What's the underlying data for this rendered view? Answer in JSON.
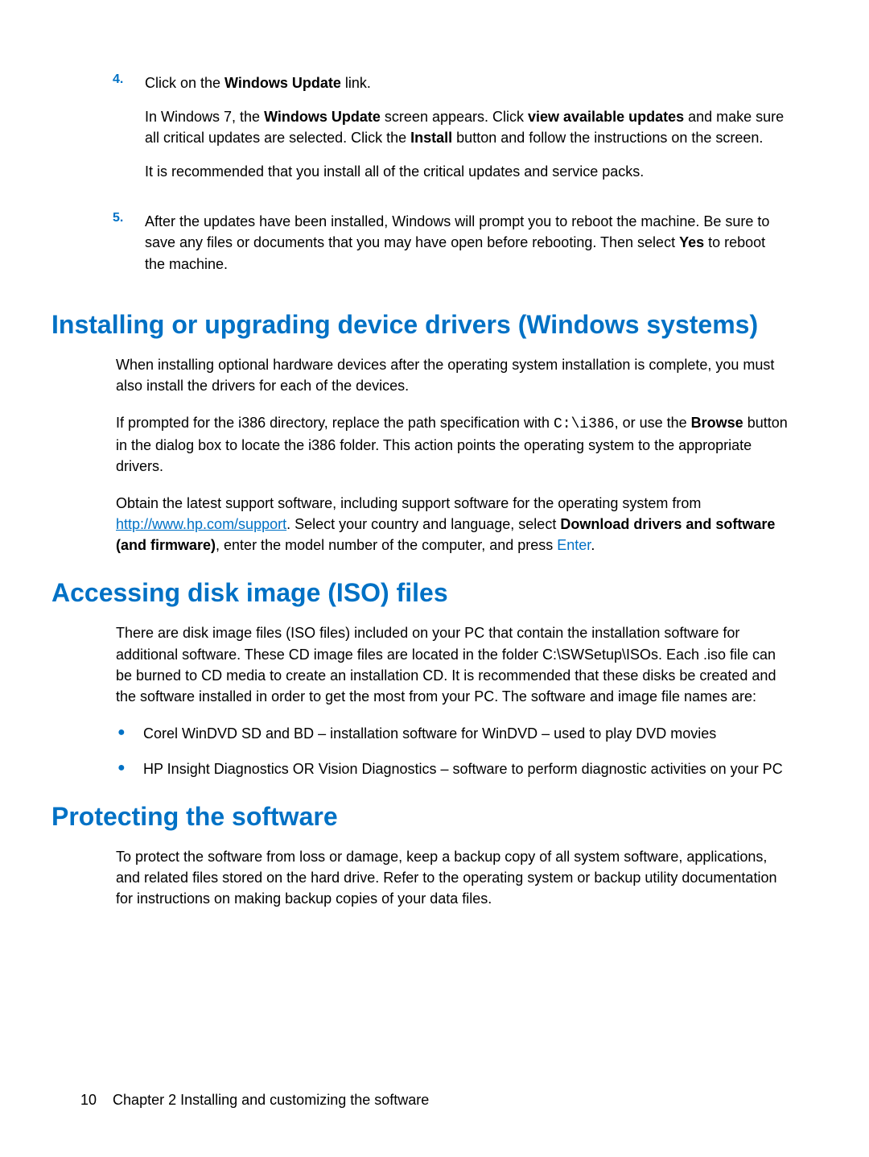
{
  "steps": {
    "s4": {
      "num": "4.",
      "line1_a": "Click on the ",
      "line1_b": "Windows Update",
      "line1_c": " link.",
      "line2_a": "In Windows 7, the ",
      "line2_b": "Windows Update",
      "line2_c": " screen appears. Click ",
      "line2_d": "view available updates",
      "line2_e": " and make sure all critical updates are selected. Click the ",
      "line2_f": "Install",
      "line2_g": " button and follow the instructions on the screen.",
      "line3": "It is recommended that you install all of the critical updates and service packs."
    },
    "s5": {
      "num": "5.",
      "line1_a": "After the updates have been installed, Windows will prompt you to reboot the machine. Be sure to save any files or documents that you may have open before rebooting. Then select ",
      "line1_b": "Yes",
      "line1_c": " to reboot the machine."
    }
  },
  "sections": {
    "installing": {
      "title": "Installing or upgrading device drivers (Windows systems)",
      "p1": "When installing optional hardware devices after the operating system installation is complete, you must also install the drivers for each of the devices.",
      "p2_a": "If prompted for the i386 directory, replace the path specification with ",
      "p2_mono": "C:\\i386",
      "p2_b": ", or use the ",
      "p2_bold": "Browse",
      "p2_c": " button in the dialog box to locate the i386 folder. This action points the operating system to the appropriate drivers.",
      "p3_a": "Obtain the latest support software, including support software for the operating system from ",
      "p3_link": "http://www.hp.com/support",
      "p3_b": ". Select your country and language, select ",
      "p3_bold": "Download drivers and software (and firmware)",
      "p3_c": ", enter the model number of the computer, and press ",
      "p3_key": "Enter",
      "p3_d": "."
    },
    "iso": {
      "title": "Accessing disk image (ISO) files",
      "p1": "There are disk image files (ISO files) included on your PC that contain the installation software for additional software. These CD image files are located in the folder C:\\SWSetup\\ISOs. Each .iso file can be burned to CD media to create an installation CD. It is recommended that these disks be created and the software installed in order to get the most from your PC. The software and image file names are:",
      "bullets": {
        "b1": "Corel WinDVD SD and BD – installation software for WinDVD – used to play DVD movies",
        "b2": "HP Insight Diagnostics OR Vision Diagnostics – software to perform diagnostic activities on your PC"
      }
    },
    "protecting": {
      "title": "Protecting the software",
      "p1": "To protect the software from loss or damage, keep a backup copy of all system software, applications, and related files stored on the hard drive. Refer to the operating system or backup utility documentation for instructions on making backup copies of your data files."
    }
  },
  "footer": {
    "pagenum": "10",
    "chapter": "Chapter 2   Installing and customizing the software"
  }
}
